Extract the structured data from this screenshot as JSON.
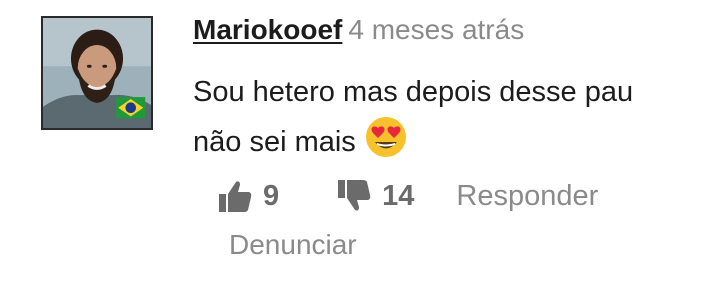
{
  "comment": {
    "username": "Mariokooef",
    "time": "4 meses atrás",
    "text_line1": "Sou hetero mas depois desse pau",
    "text_line2": "não sei mais",
    "emoji": "heart-eyes-emoji"
  },
  "actions": {
    "likes": "9",
    "dislikes": "14",
    "reply_label": "Responder",
    "report_label": "Denunciar"
  },
  "icons": {
    "like": "thumbs-up-icon",
    "dislike": "thumbs-down-icon",
    "avatar_flag": "brazil-flag-icon"
  },
  "colors": {
    "username": "#1c1c1c",
    "muted": "#8a8a8a",
    "action": "#6b6b6b",
    "emoji_face": "#f7c12c",
    "emoji_heart": "#e8263c"
  }
}
